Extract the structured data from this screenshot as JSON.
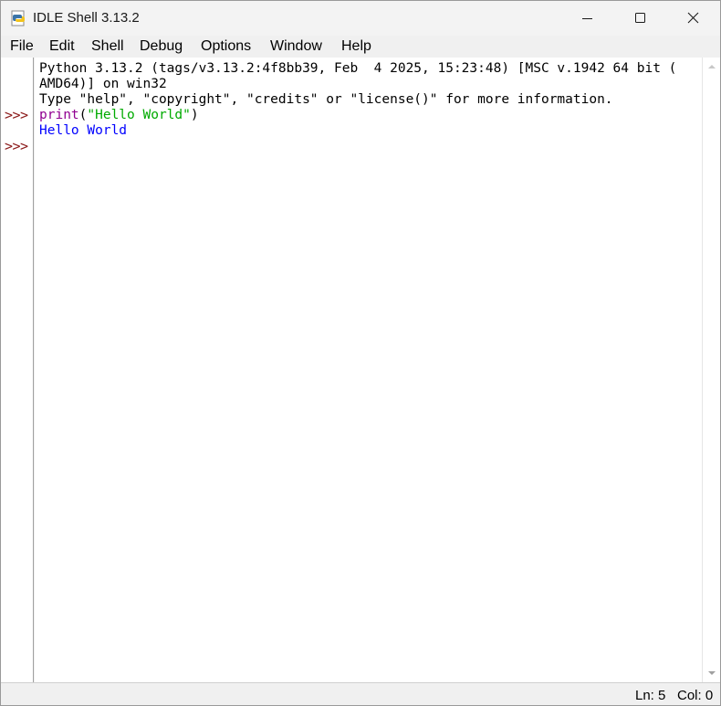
{
  "window": {
    "title": "IDLE Shell 3.13.2"
  },
  "menu": [
    "File",
    "Edit",
    "Shell",
    "Debug",
    "Options",
    "Window",
    "Help"
  ],
  "shell": {
    "banner_line1": "Python 3.13.2 (tags/v3.13.2:4f8bb39, Feb  4 2025, 15:23:48) [MSC v.1942 64 bit (",
    "banner_line2": "AMD64)] on win32",
    "banner_line3": "Type \"help\", \"copyright\", \"credits\" or \"license()\" for more information.",
    "prompt": ">>>",
    "input_func": "print",
    "input_open": "(",
    "input_string": "\"Hello World\"",
    "input_close": ")",
    "output": "Hello World"
  },
  "status": {
    "line": "Ln: 5",
    "col": "Col: 0"
  },
  "colors": {
    "prompt": "#8b1a1a",
    "builtin": "#900090",
    "string": "#00aa00",
    "stdout": "#0000ff"
  },
  "icons": {
    "app": "python-idle-icon",
    "minimize": "minimize-icon",
    "maximize": "maximize-icon",
    "close": "close-icon"
  }
}
